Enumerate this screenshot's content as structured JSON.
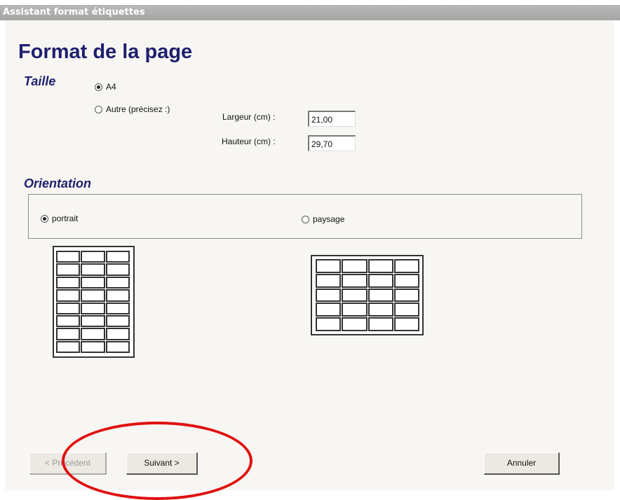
{
  "window": {
    "title": "Assistant format étiquettes"
  },
  "page": {
    "title": "Format de la page"
  },
  "taille": {
    "heading": "Taille",
    "option_a4": "A4",
    "option_other": "Autre (précisez :)",
    "width_label": "Largeur (cm) :",
    "width_value": "21,00",
    "height_label": "Hauteur (cm) :",
    "height_value": "29,70",
    "selected": "A4"
  },
  "orientation": {
    "heading": "Orientation",
    "portrait_label": "portrait",
    "landscape_label": "paysage",
    "selected": "portrait",
    "portrait_grid": {
      "rows": 8,
      "cols": 3
    },
    "landscape_grid": {
      "rows": 5,
      "cols": 4
    }
  },
  "buttons": {
    "previous": "< Précédent",
    "next": "Suivant >",
    "cancel": "Annuler"
  },
  "colors": {
    "heading": "#1f1f6e",
    "annotation": "#e01010",
    "titlebar": "#a8a8a8"
  }
}
